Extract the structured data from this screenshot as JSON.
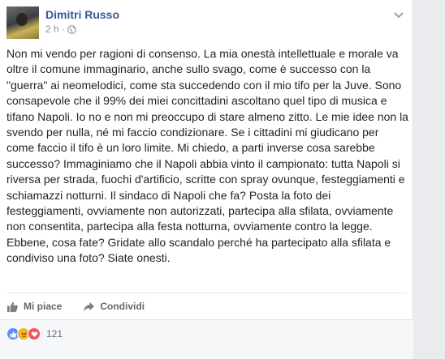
{
  "post": {
    "author": "Dimitri Russo",
    "time": "2 h",
    "separator": "·",
    "text": "Non mi vendo per ragioni di consenso. La mia onestà intellettuale e morale va oltre il comune immaginario, anche sullo svago, come è successo con la \"guerra\" ai neomelodici, come sta succedendo con il mio tifo per la Juve. Sono consapevole che il 99% dei miei concittadini ascoltano quel tipo di musica e tifano Napoli. Io no e non mi preoccupo di stare almeno zitto. Le mie idee non la svendo per nulla, né mi faccio condizionare. Se i cittadini mi giudicano per come faccio il tifo è un loro limite. Mi chiedo, a parti inverse cosa sarebbe successo? Immaginiamo che il Napoli abbia vinto il campionato: tutta Napoli si riversa per strada, fuochi d'artificio, scritte con spray ovunque, festeggiamenti e schiamazzi notturni. Il sindaco di Napoli che fa? Posta la foto dei festeggiamenti, ovviamente non autorizzati, partecipa alla sfilata, ovviamente non consentita, partecipa alla festa notturna, ovviamente contro la legge. Ebbene, cosa fate? Gridate allo scandalo perché ha partecipato alla sfilata e condiviso una foto? Siate onesti."
  },
  "actions": {
    "like_label": "Mi piace",
    "share_label": "Condividi"
  },
  "reactions": {
    "icons": [
      "like-icon",
      "angry-icon",
      "love-icon"
    ],
    "count": "121"
  },
  "colors": {
    "author": "#365899",
    "like": "#5890ff",
    "angry": "#f7b125",
    "love": "#f25268"
  }
}
